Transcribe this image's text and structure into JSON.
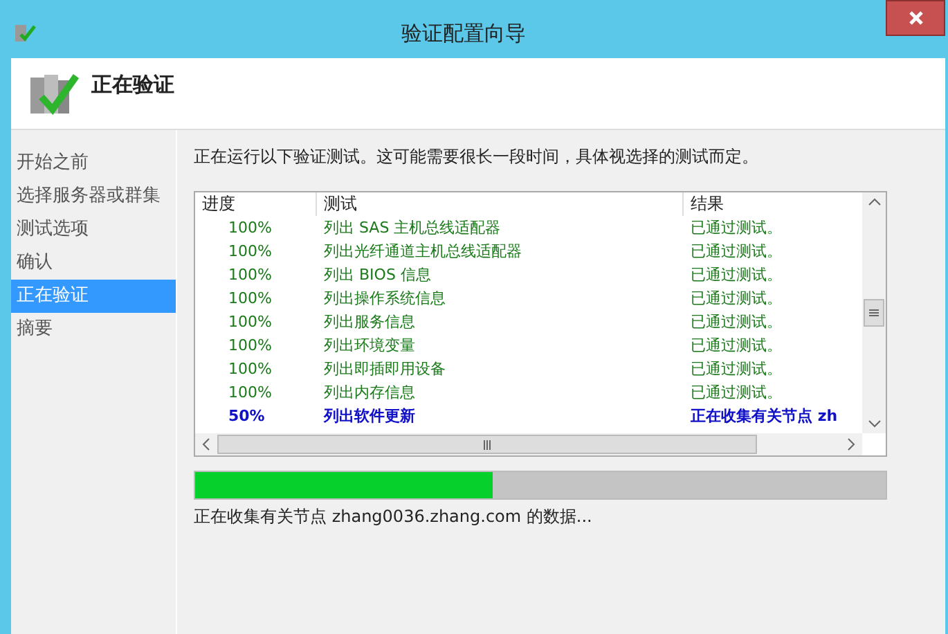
{
  "window": {
    "title": "验证配置向导"
  },
  "header": {
    "title": "正在验证"
  },
  "sidebar": {
    "items": [
      {
        "label": "开始之前",
        "selected": false
      },
      {
        "label": "选择服务器或群集",
        "selected": false
      },
      {
        "label": "测试选项",
        "selected": false
      },
      {
        "label": "确认",
        "selected": false
      },
      {
        "label": "正在验证",
        "selected": true
      },
      {
        "label": "摘要",
        "selected": false
      }
    ]
  },
  "intro": "正在运行以下验证测试。这可能需要很长一段时间，具体视选择的测试而定。",
  "table": {
    "columns": [
      "进度",
      "测试",
      "结果"
    ],
    "rows": [
      {
        "kind": "done",
        "progress": "100%",
        "test": "列出 SAS 主机总线适配器",
        "result": "已通过测试。"
      },
      {
        "kind": "done",
        "progress": "100%",
        "test": "列出光纤通道主机总线适配器",
        "result": "已通过测试。"
      },
      {
        "kind": "done",
        "progress": "100%",
        "test": "列出 BIOS 信息",
        "result": "已通过测试。"
      },
      {
        "kind": "done",
        "progress": "100%",
        "test": "列出操作系统信息",
        "result": "已通过测试。"
      },
      {
        "kind": "done",
        "progress": "100%",
        "test": "列出服务信息",
        "result": "已通过测试。"
      },
      {
        "kind": "done",
        "progress": "100%",
        "test": "列出环境变量",
        "result": "已通过测试。"
      },
      {
        "kind": "done",
        "progress": "100%",
        "test": "列出即插即用设备",
        "result": "已通过测试。"
      },
      {
        "kind": "done",
        "progress": "100%",
        "test": "列出内存信息",
        "result": "已通过测试。"
      },
      {
        "kind": "running",
        "progress": "50%",
        "test": "列出软件更新",
        "result": "正在收集有关节点 zh"
      }
    ]
  },
  "progress": {
    "level": 0.43
  },
  "status": "正在收集有关节点 zhang0036.zhang.com 的数据..."
}
